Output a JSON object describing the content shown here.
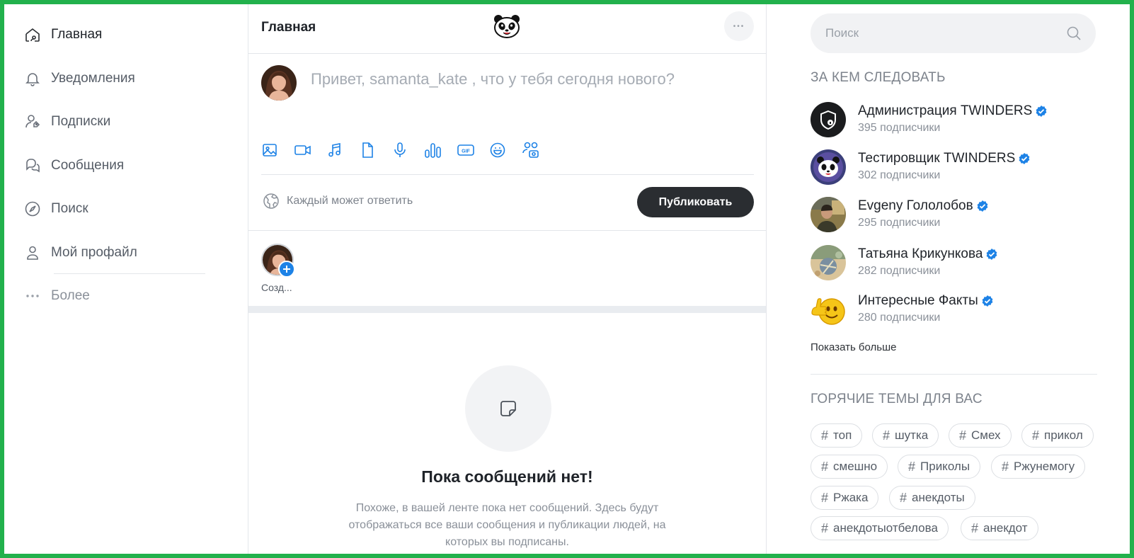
{
  "nav": {
    "items": [
      {
        "label": "Главная",
        "icon": "home-icon"
      },
      {
        "label": "Уведомления",
        "icon": "bell-icon"
      },
      {
        "label": "Подписки",
        "icon": "subscriptions-icon"
      },
      {
        "label": "Сообщения",
        "icon": "messages-icon"
      },
      {
        "label": "Поиск",
        "icon": "compass-icon"
      },
      {
        "label": "Мой профайл",
        "icon": "user-icon"
      }
    ],
    "more_label": "Более"
  },
  "header": {
    "title": "Главная",
    "logo_icon": "panda-logo-icon",
    "menu_label": "•••"
  },
  "composer": {
    "placeholder": "Привет, samanta_kate , что у тебя сегодня нового?",
    "tools": [
      "image-icon",
      "video-icon",
      "music-icon",
      "file-icon",
      "microphone-icon",
      "poll-icon",
      "gif-icon",
      "emoji-icon",
      "tag-people-icon"
    ],
    "reply_setting": "Каждый может ответить",
    "publish_label": "Публиковать"
  },
  "stories": {
    "create_label": "Созд..."
  },
  "feed": {
    "empty_title": "Пока сообщений нет!",
    "empty_text": "Похоже, в вашей ленте пока нет сообщений. Здесь будут отображаться все ваши сообщения и публикации людей, на которых вы подписаны."
  },
  "right": {
    "search_placeholder": "Поиск",
    "follow_title": "ЗА КЕМ СЛЕДОВАТЬ",
    "follow": [
      {
        "name": "Администрация TWINDERS",
        "count": "395 подписчики"
      },
      {
        "name": "Тестировщик TWINDERS",
        "count": "302 подписчики"
      },
      {
        "name": "Evgeny Гололобов",
        "count": "295 подписчики"
      },
      {
        "name": "Татьяна Крикункова",
        "count": "282 подписчики"
      },
      {
        "name": "Интересные Факты",
        "count": "280 подписчики"
      }
    ],
    "show_more": "Показать больше",
    "topics_title": "ГОРЯЧИЕ ТЕМЫ ДЛЯ ВАС",
    "tags": [
      "топ",
      "шутка",
      "Смех",
      "прикол",
      "смешно",
      "Приколы",
      "Ржунемогу",
      "Ржака",
      "анекдоты",
      "анекдотыотбелова",
      "анекдот"
    ]
  },
  "colors": {
    "accent": "#1d82e6",
    "button_dark": "#2a2d31",
    "frame": "#22b14c"
  }
}
